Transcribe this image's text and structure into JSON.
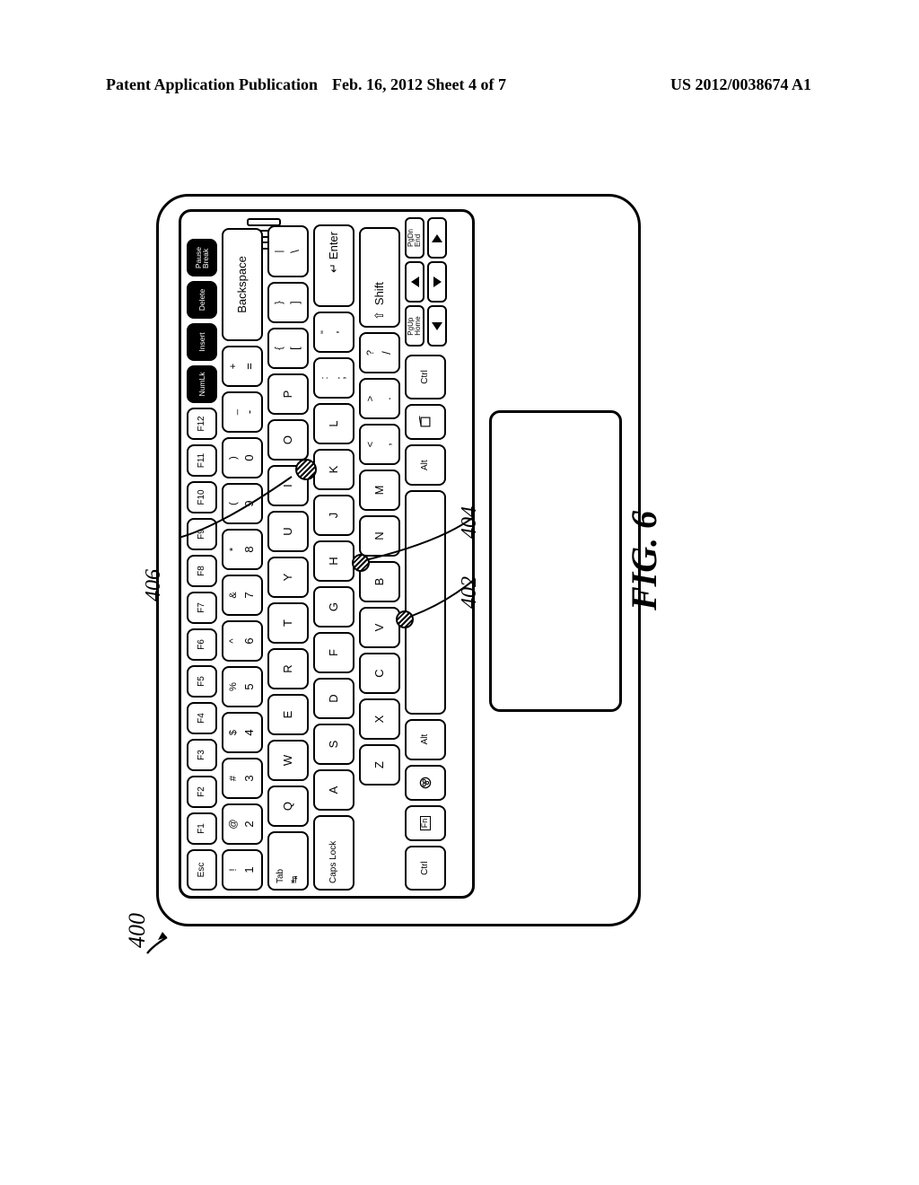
{
  "header": {
    "left": "Patent Application Publication",
    "mid": "Feb. 16, 2012  Sheet 4 of 7",
    "right": "US 2012/0038674 A1"
  },
  "figure": {
    "ref_top": "400",
    "ref_406": "406",
    "ref_404": "404",
    "ref_402": "402",
    "caption": "FIG. 6"
  },
  "keys": {
    "row0": [
      "Esc",
      "F1",
      "F2",
      "F3",
      "F4",
      "F5",
      "F6",
      "F7",
      "F8",
      "F9",
      "F10",
      "F11",
      "F12",
      "NumLk",
      "Insert",
      "Delete"
    ],
    "pause": "Pause\nBreak",
    "row1_pairs": [
      [
        "!",
        "1"
      ],
      [
        "@",
        "2"
      ],
      [
        "#",
        "3"
      ],
      [
        "$",
        "4"
      ],
      [
        "%",
        "5"
      ],
      [
        "^",
        "6"
      ],
      [
        "&",
        "7"
      ],
      [
        "*",
        "8"
      ],
      [
        "(",
        "9"
      ],
      [
        ")",
        "0"
      ],
      [
        "_",
        "-"
      ],
      [
        "+",
        "="
      ]
    ],
    "backspace": "Backspace",
    "tab": "Tab",
    "row2": [
      "Q",
      "W",
      "E",
      "R",
      "T",
      "Y",
      "U",
      "I",
      "O",
      "P"
    ],
    "row2_br": [
      [
        "{",
        "["
      ],
      [
        "}",
        "]"
      ],
      [
        "|",
        "\\"
      ]
    ],
    "caps": "Caps Lock",
    "row3": [
      "A",
      "S",
      "D",
      "F",
      "G",
      "H",
      "J",
      "K",
      "L"
    ],
    "row3_br": [
      [
        ":",
        ";"
      ],
      [
        "\"",
        "'"
      ]
    ],
    "enter": "Enter",
    "shift": "Shift",
    "row4": [
      "Z",
      "X",
      "C",
      "V",
      "B",
      "N",
      "M"
    ],
    "row4_br": [
      [
        "<",
        ","
      ],
      [
        ">",
        "."
      ],
      [
        "?",
        "/"
      ]
    ],
    "row5": {
      "ctrl": "Ctrl",
      "fn": "Fn",
      "alt": "Alt",
      "pgup": "PgUp\nHome",
      "pgdn": "PgDn\nEnd"
    }
  }
}
